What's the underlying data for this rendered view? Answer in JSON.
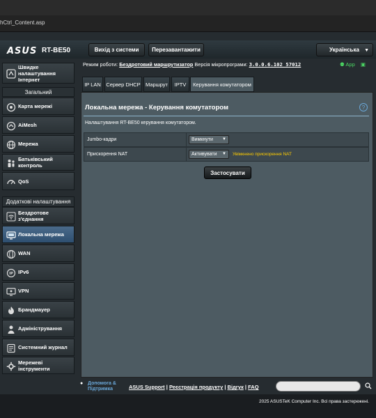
{
  "browser": {
    "url": "hCtrl_Content.asp"
  },
  "header": {
    "logo": "ASUS",
    "model": "RT-BE50",
    "logout_label": "Вихід з системи",
    "reboot_label": "Перезавантажити",
    "language": "Українська"
  },
  "status": {
    "mode_label": "Режим роботи:",
    "mode_value": "Бездротовий маршрутизатор",
    "fw_label": "Версія мікропрограми:",
    "fw_value": "3.0.0.6.102_57012",
    "app_label": "App"
  },
  "sidebar": {
    "quick_setup": "Швидке налаштування Інтернет",
    "general_header": "Загальний",
    "general": [
      {
        "label": "Карта мережі",
        "icon": "network-map-icon"
      },
      {
        "label": "AiMesh",
        "icon": "aimesh-icon"
      },
      {
        "label": "Мережа",
        "icon": "globe-icon"
      },
      {
        "label": "Батьківський контроль",
        "icon": "parental-icon"
      },
      {
        "label": "QoS",
        "icon": "qos-icon"
      }
    ],
    "advanced_header": "Додаткові налаштування",
    "advanced": [
      {
        "label": "Бездротове з'єднання",
        "icon": "wifi-icon"
      },
      {
        "label": "Локальна мережа",
        "icon": "lan-icon"
      },
      {
        "label": "WAN",
        "icon": "wan-icon"
      },
      {
        "label": "IPv6",
        "icon": "ipv6-icon"
      },
      {
        "label": "VPN",
        "icon": "vpn-icon"
      },
      {
        "label": "Брандмауер",
        "icon": "firewall-icon"
      },
      {
        "label": "Адміністрування",
        "icon": "admin-icon"
      },
      {
        "label": "Системний журнал",
        "icon": "syslog-icon"
      },
      {
        "label": "Мережеві інструменти",
        "icon": "tools-icon"
      }
    ]
  },
  "tabs": [
    {
      "label": "IP LAN"
    },
    {
      "label": "Сервер DHCP"
    },
    {
      "label": "Маршрут"
    },
    {
      "label": "IPTV"
    },
    {
      "label": "Керування комутатором"
    }
  ],
  "content": {
    "title": "Локальна мережа - Керування комутатором",
    "description": "Налаштування RT-BE50 керування комутатором.",
    "rows": [
      {
        "label": "Jumbo-кадри",
        "value": "Вимкнути",
        "note": ""
      },
      {
        "label": "Прискорення NAT",
        "value": "Активувати",
        "note": "Увімкнено прискорення NAT"
      }
    ],
    "apply_label": "Застосувати"
  },
  "footer": {
    "help_label": "Допомога & Підтримка",
    "links": [
      "ASUS Support",
      "Реєстрація продукту",
      "Відгук",
      "FAQ"
    ],
    "copyright": "2025 ASUSTeK Computer Inc. Всі права застережені."
  },
  "colors": {
    "accent": "#6aa7d8",
    "highlight": "#ffcc00",
    "app": "#4cd964"
  }
}
